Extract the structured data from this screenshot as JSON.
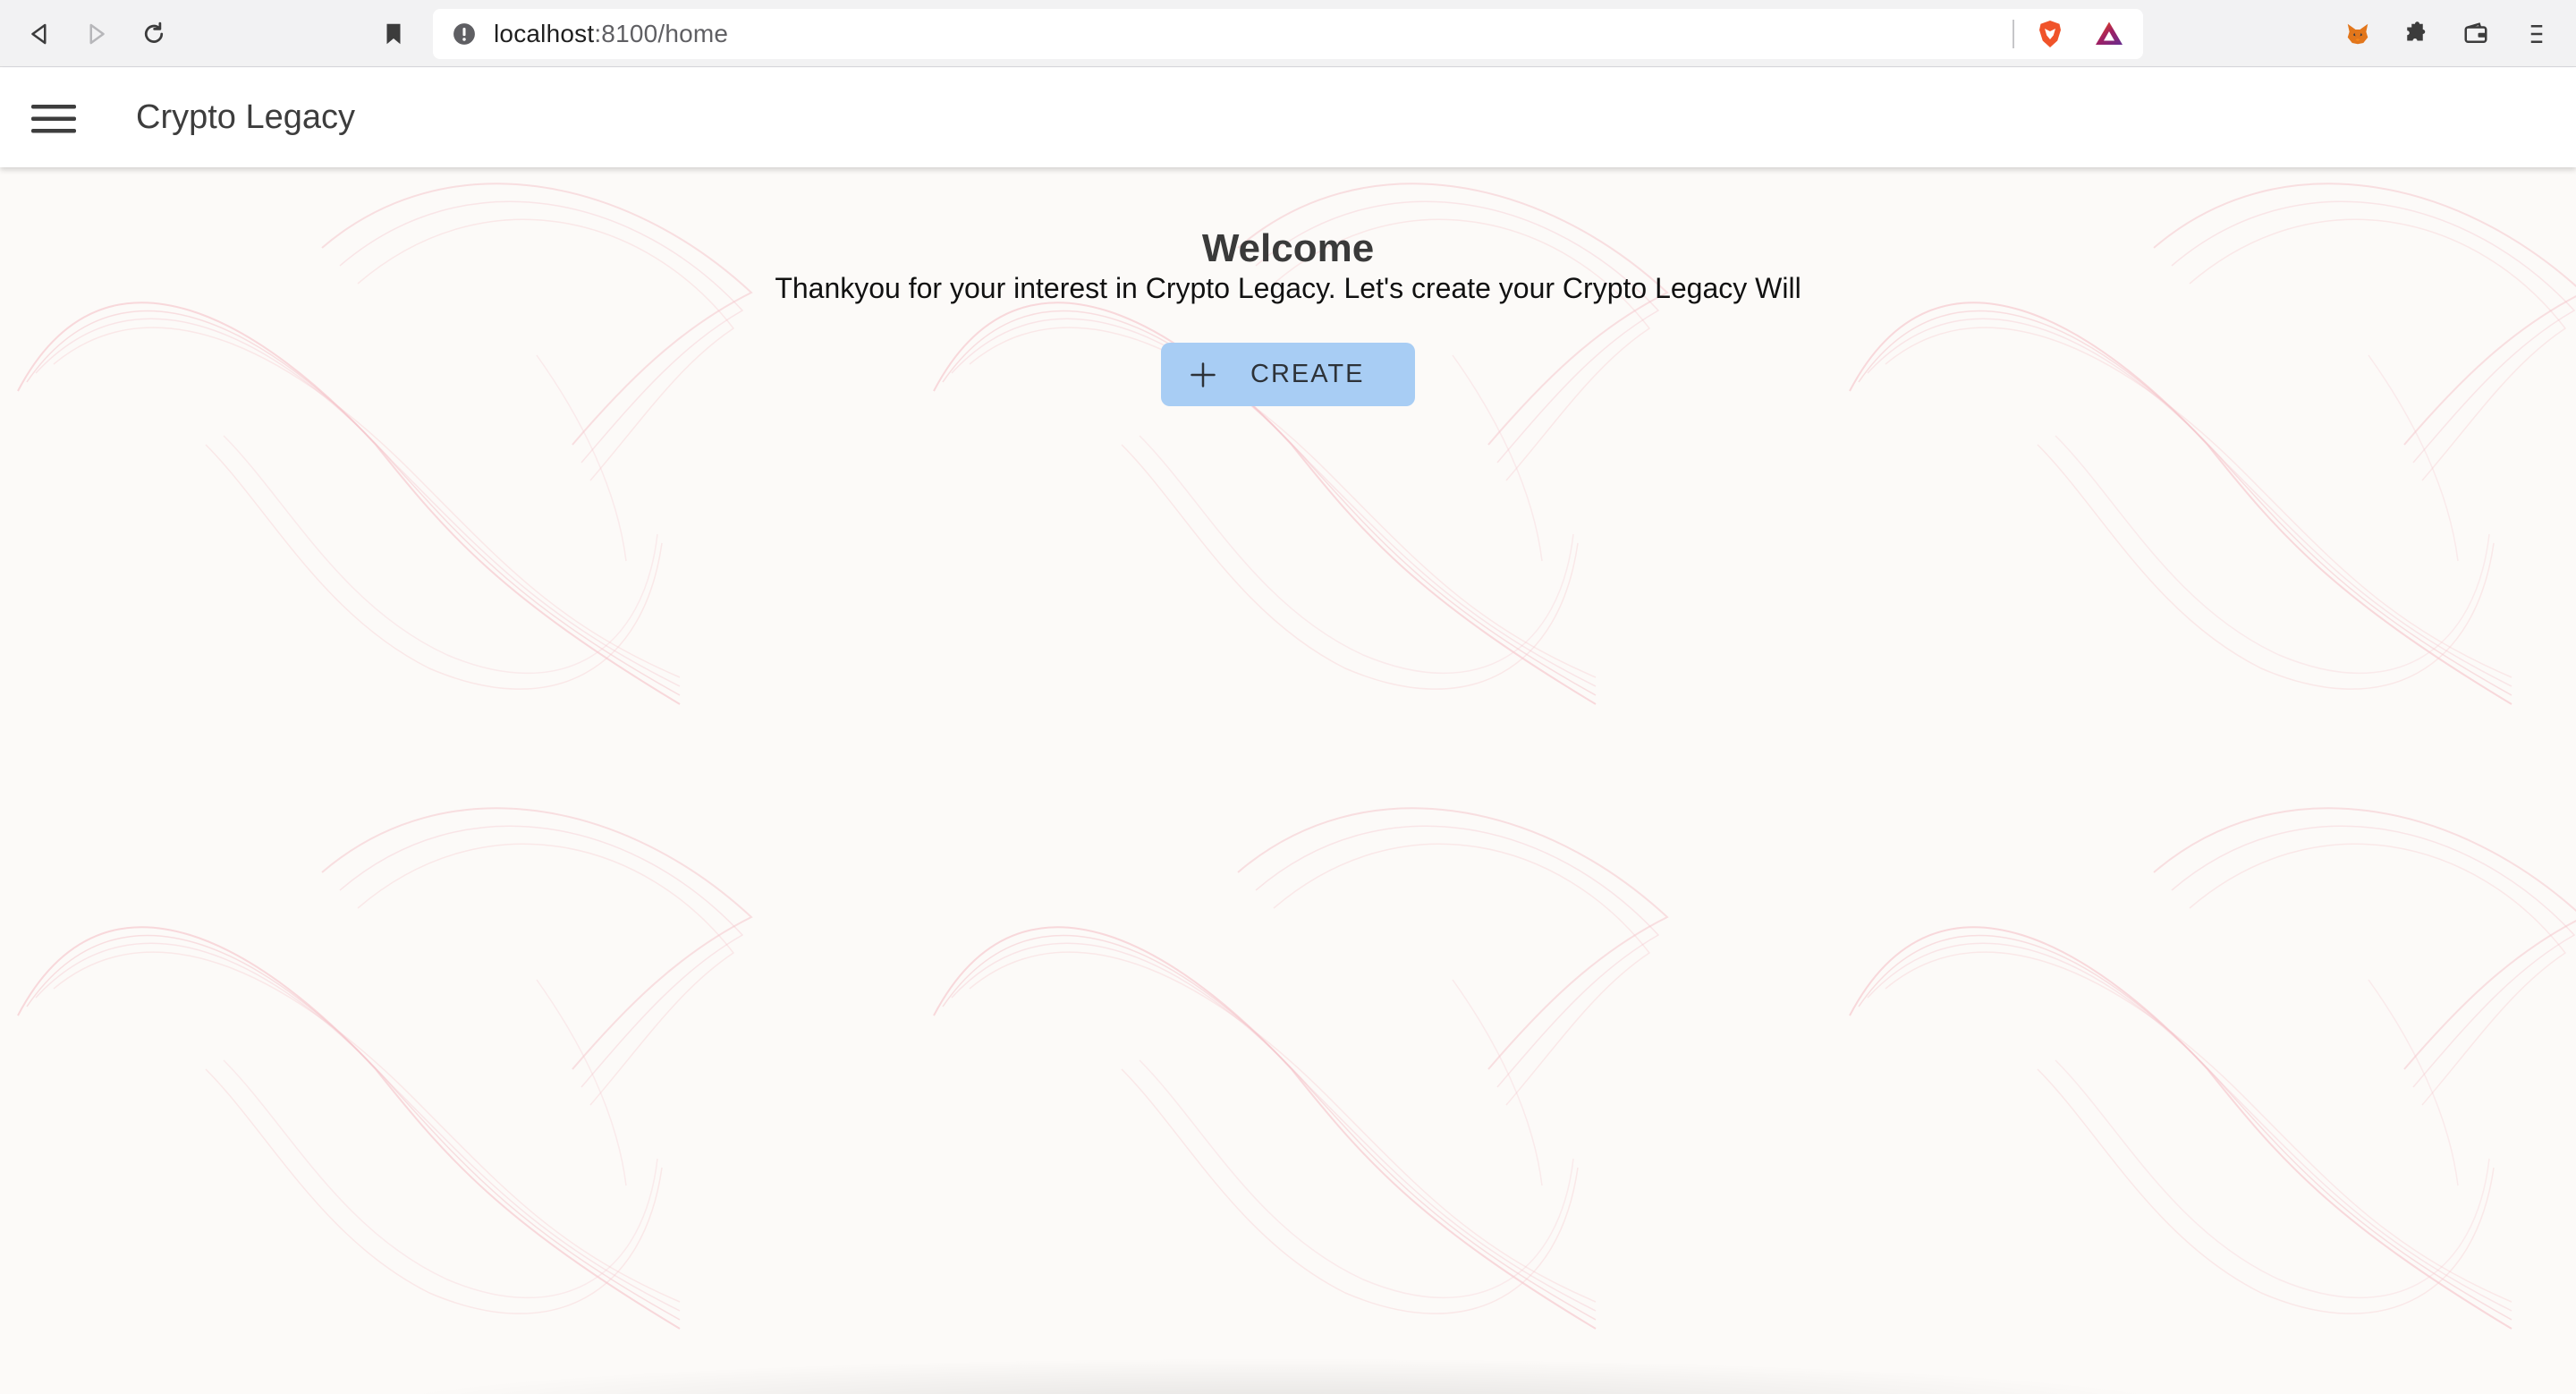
{
  "browser": {
    "url_host": "localhost",
    "url_path": ":8100/home",
    "icons": {
      "back": "back-icon",
      "forward": "forward-icon",
      "reload": "reload-icon",
      "bookmark": "bookmark-icon",
      "site_info": "info-icon",
      "brave_shield": "brave-shield-icon",
      "brave_rewards": "brave-rewards-icon",
      "metamask": "metamask-fox-icon",
      "extensions": "puzzle-icon",
      "wallet": "wallet-icon",
      "menu": "hamburger-menu-icon"
    }
  },
  "header": {
    "title": "Crypto Legacy",
    "menu_icon": "hamburger-menu-icon"
  },
  "main": {
    "welcome_title": "Welcome",
    "welcome_text": "Thankyou for your interest in Crypto Legacy. Let's create your Crypto Legacy Will",
    "create_label": "CREATE",
    "create_icon": "plus-icon"
  },
  "colors": {
    "create_button_bg": "#a8cdf4",
    "content_bg": "#fcfaf8",
    "pattern_stroke": "#f2b8bf"
  }
}
